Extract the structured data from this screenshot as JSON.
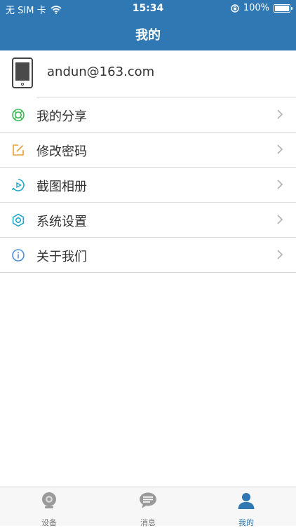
{
  "status_bar": {
    "carrier": "无 SIM 卡",
    "time": "15:34",
    "battery": "100%"
  },
  "nav": {
    "title": "我的"
  },
  "profile": {
    "email": "andun@163.com"
  },
  "menu": [
    {
      "label": "我的分享",
      "icon": "share-ring-icon",
      "color": "#3cba54"
    },
    {
      "label": "修改密码",
      "icon": "edit-icon",
      "color": "#e8a13a"
    },
    {
      "label": "截图相册",
      "icon": "play-album-icon",
      "color": "#1fa8c9"
    },
    {
      "label": "系统设置",
      "icon": "gear-icon",
      "color": "#1fa8c9"
    },
    {
      "label": "关于我们",
      "icon": "info-icon",
      "color": "#4a90d9"
    }
  ],
  "tabbar": {
    "tabs": [
      {
        "label": "设备",
        "icon": "camera-icon"
      },
      {
        "label": "消息",
        "icon": "chat-bubble-icon"
      },
      {
        "label": "我的",
        "icon": "person-icon"
      }
    ],
    "active_index": 2,
    "active_color": "#2f78b3"
  }
}
